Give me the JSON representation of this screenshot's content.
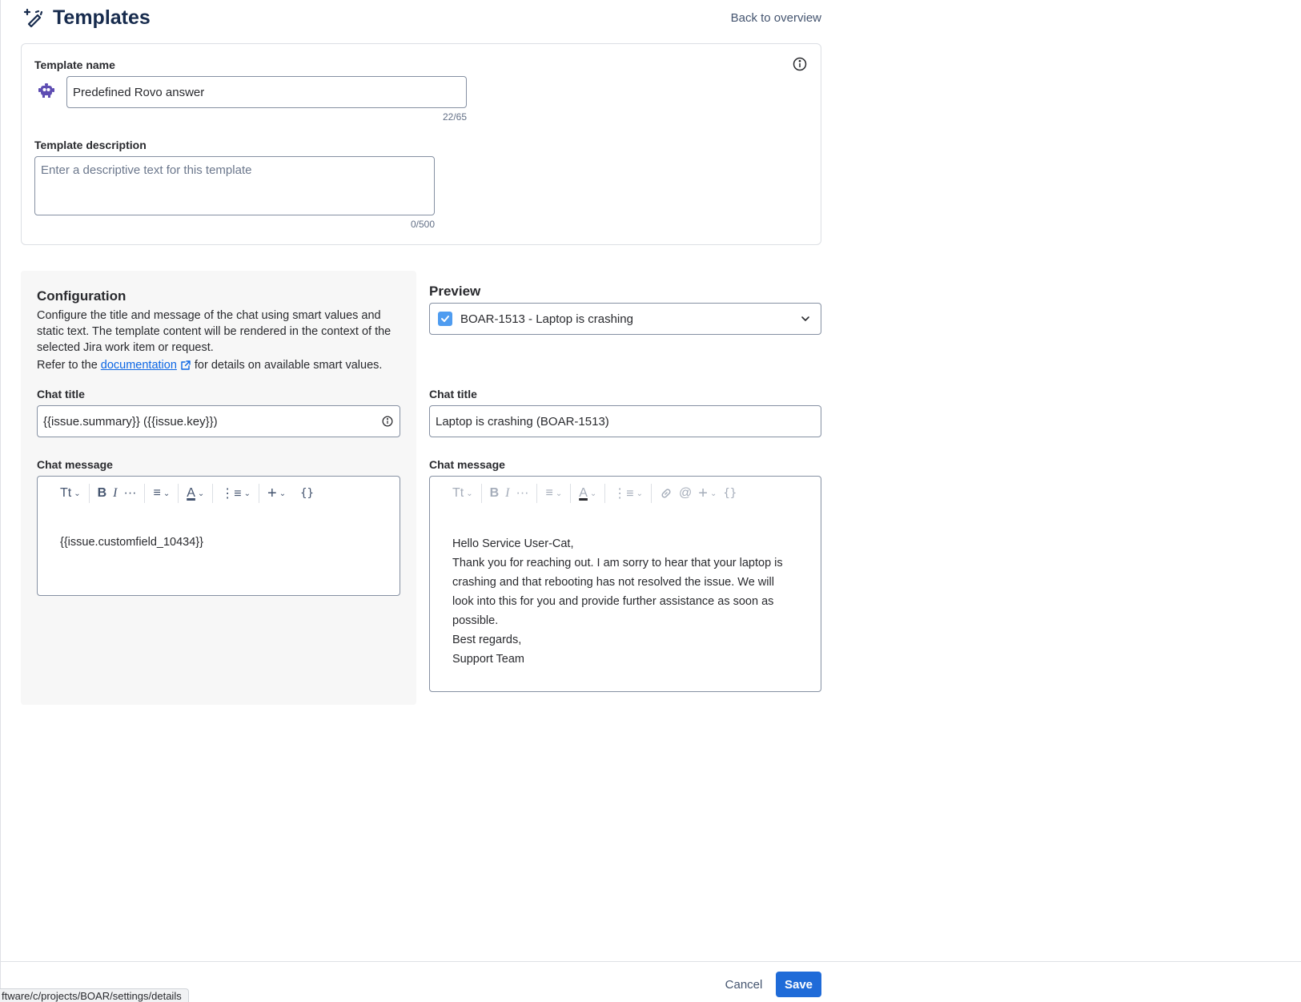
{
  "header": {
    "title": "Templates",
    "back_label": "Back to overview"
  },
  "template_name": {
    "label": "Template name",
    "value": "Predefined Rovo answer",
    "counter": "22/65"
  },
  "template_description": {
    "label": "Template description",
    "placeholder": "Enter a descriptive text for this template",
    "counter": "0/500"
  },
  "configuration": {
    "title": "Configuration",
    "description": "Configure the title and message of the chat using smart values and static text. The template content will be rendered in the context of the selected Jira work item or request.",
    "refer_prefix": "Refer to the",
    "doc_link": "documentation",
    "refer_suffix": "for details on available smart values.",
    "chat_title_label": "Chat title",
    "chat_title_value": "{{issue.summary}} ({{issue.key}})",
    "chat_message_label": "Chat message",
    "chat_message_value": "{{issue.customfield_10434}}"
  },
  "preview": {
    "title": "Preview",
    "selected_item": "BOAR-1513 - Laptop is crashing",
    "chat_title_label": "Chat title",
    "chat_title_value": "Laptop is crashing (BOAR-1513)",
    "chat_message_label": "Chat message",
    "message_lines": [
      "Hello Service User-Cat,",
      "Thank you for reaching out. I am sorry to hear that your laptop is",
      "crashing and that rebooting has not resolved the issue. We will",
      "look into this for you and provide further assistance as soon as",
      "possible.",
      "Best regards,",
      "Support Team"
    ]
  },
  "toolbar": {
    "text_style": "Tt",
    "bold": "B",
    "italic": "I",
    "more": "···",
    "text_color": "A",
    "insert": "+",
    "smart_values": "{}"
  },
  "footer": {
    "cancel_label": "Cancel",
    "save_label": "Save"
  },
  "status_bar": {
    "url": "ftware/c/projects/BOAR/settings/details"
  },
  "colors": {
    "primary": "#1f6bd8",
    "link": "#0c66e4",
    "checkbox": "#4f9cf0",
    "rovo_icon": "#5e4db2"
  }
}
